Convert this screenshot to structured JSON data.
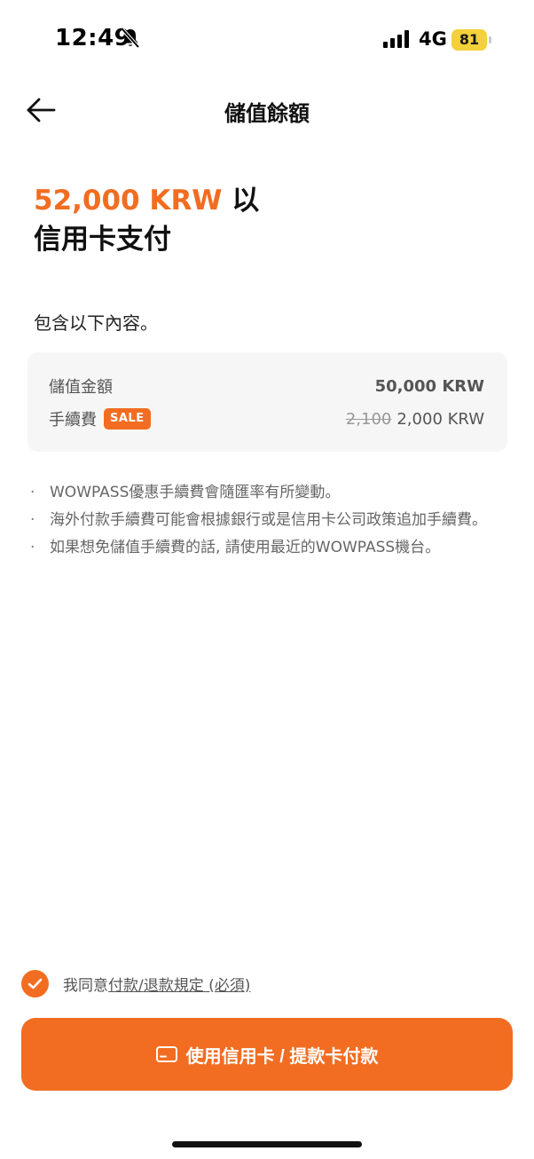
{
  "status_bar": {
    "time": "12:49",
    "network": "4G",
    "battery": "81",
    "icons": [
      "bell-slash-icon",
      "signal-icon",
      "battery-icon"
    ]
  },
  "header": {
    "title": "儲值餘額",
    "back_icon": "arrow-left-icon"
  },
  "headline": {
    "amount": "52,000 KRW",
    "suffix": " 以",
    "line2": "信用卡支付"
  },
  "includes_label": "包含以下內容。",
  "summary": {
    "charge_label": "儲值金額",
    "charge_value": "50,000 KRW",
    "fee_label": "手續費",
    "sale_badge": "SALE",
    "fee_original": "2,100",
    "fee_value": "2,000 KRW"
  },
  "notes": [
    {
      "bullet": "·",
      "text": "WOWPASS優惠手續費會隨匯率有所變動。"
    },
    {
      "bullet": "·",
      "text": "海外付款手續費可能會根據銀行或是信用卡公司政策追加手續費。"
    },
    {
      "bullet": "·",
      "text": "如果想免儲值手續費的話, 請使用最近的WOWPASS機台。"
    }
  ],
  "agreement": {
    "prefix": "我同意",
    "link_payment": "付款",
    "separator": "/",
    "link_refund": "退款規定",
    "suffix": " (必須)",
    "checked": true
  },
  "pay_button": {
    "label": "使用信用卡 / 提款卡付款",
    "icon": "credit-card-icon"
  },
  "colors": {
    "accent": "#f26d21",
    "battery": "#f4d03a",
    "card_bg": "#f6f6f6"
  }
}
